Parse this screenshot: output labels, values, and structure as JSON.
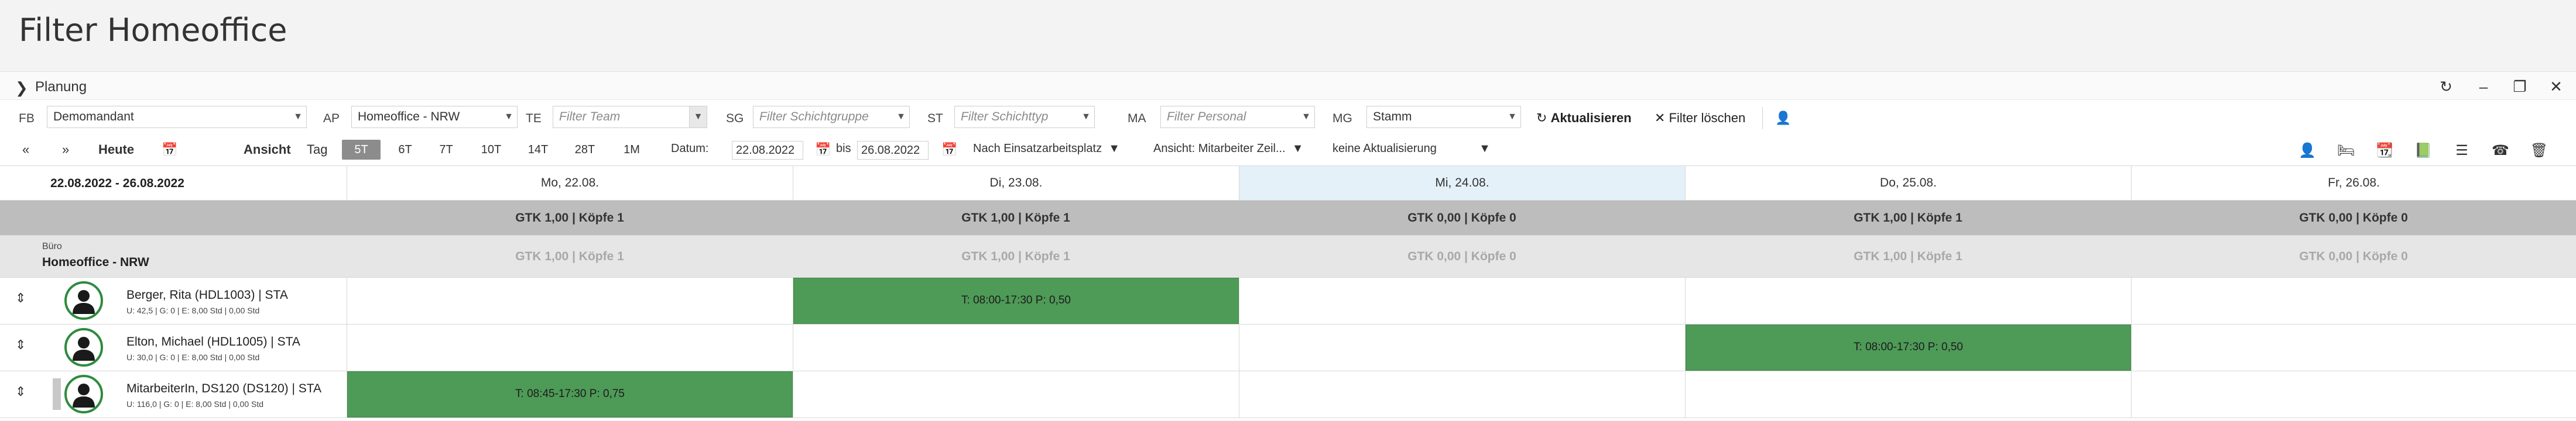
{
  "page": {
    "title": "Filter Homeoffice"
  },
  "panel": {
    "label": "Planung"
  },
  "filters": {
    "fb": {
      "label": "FB",
      "value": "Demomandant"
    },
    "ap": {
      "label": "AP",
      "value": "Homeoffice - NRW"
    },
    "te": {
      "label": "TE",
      "placeholder": "Filter Team"
    },
    "sg": {
      "label": "SG",
      "placeholder": "Filter Schichtgruppe"
    },
    "st": {
      "label": "ST",
      "placeholder": "Filter Schichttyp"
    },
    "ma": {
      "label": "MA",
      "placeholder": "Filter Personal"
    },
    "mg": {
      "label": "MG",
      "value": "Stamm"
    },
    "refresh_label": "Aktualisieren",
    "clear_label": "Filter löschen"
  },
  "toolbar": {
    "prev": "«",
    "next": "»",
    "today": "Heute",
    "view_label": "Ansicht",
    "day_label": "Tag",
    "segments": [
      "5T",
      "6T",
      "7T",
      "10T",
      "14T",
      "28T",
      "1M"
    ],
    "active_segment": "5T",
    "date_label": "Datum:",
    "date_from": "22.08.2022",
    "bis": "bis",
    "date_to": "26.08.2022",
    "sort": "Nach Einsatzarbeitsplatz",
    "view": "Ansicht: Mitarbeiter Zeil...",
    "update": "keine Aktualisierung"
  },
  "calendar": {
    "range": "22.08.2022 - 26.08.2022",
    "days": [
      {
        "label": "Mo, 22.08.",
        "gtk": "GTK 1,00 | Köpfe 1",
        "gtk_sub": "GTK 1,00 | Köpfe 1"
      },
      {
        "label": "Di, 23.08.",
        "gtk": "GTK 1,00 | Köpfe 1",
        "gtk_sub": "GTK 1,00 | Köpfe 1"
      },
      {
        "label": "Mi, 24.08.",
        "gtk": "GTK 0,00 | Köpfe 0",
        "gtk_sub": "GTK 0,00 | Köpfe 0"
      },
      {
        "label": "Do, 25.08.",
        "gtk": "GTK 1,00 | Köpfe 1",
        "gtk_sub": "GTK 1,00 | Köpfe 1"
      },
      {
        "label": "Fr, 26.08.",
        "gtk": "GTK 0,00 | Köpfe 0",
        "gtk_sub": "GTK 0,00 | Köpfe 0"
      }
    ],
    "group_sub": "Büro",
    "group_name": "Homeoffice - NRW"
  },
  "employees": [
    {
      "name": "Berger, Rita (HDL1003) | STA",
      "meta": "U: 42,5 | G: 0 | E: 8,00 Std | 0,00 Std",
      "shift": "T: 08:00-17:30 P: 0,50"
    },
    {
      "name": "Elton, Michael (HDL1005) | STA",
      "meta": "U: 30,0 | G: 0 | E: 8,00 Std | 0,00 Std",
      "shift": "T: 08:00-17:30 P: 0,50"
    },
    {
      "name": "MitarbeiterIn, DS120 (DS120) | STA",
      "meta": "U: 116,0 | G: 0 | E: 8,00 Std | 0,00 Std",
      "shift": "T: 08:45-17:30 P: 0,75"
    }
  ]
}
